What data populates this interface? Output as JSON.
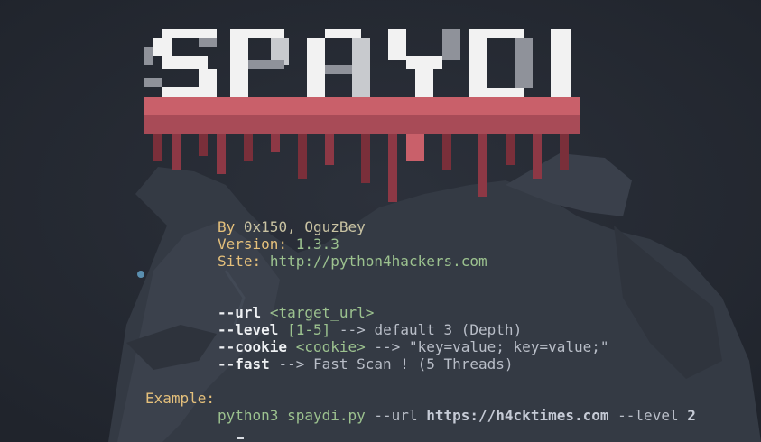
{
  "banner": {
    "logo_text": "SPAYDI",
    "colors": {
      "white": "#f2f2f2",
      "gray": "#8f929a",
      "red": "#c9606a",
      "dark_red": "#7a2f3a"
    }
  },
  "credits": {
    "by_label": "By",
    "authors": "0x150, OguzBey",
    "version_label": "Version:",
    "version": "1.3.3",
    "site_label": "Site:",
    "site_url": "http://python4hackers.com"
  },
  "options": {
    "url": {
      "flag": "--url",
      "arg": "<target_url>"
    },
    "level": {
      "flag": "--level",
      "arg": "[1-5]",
      "arrow": "-->",
      "desc": "default 3 (Depth)"
    },
    "cookie": {
      "flag": "--cookie",
      "arg": "<cookie>",
      "arrow": "-->",
      "desc": "\"key=value; key=value;\""
    },
    "fast": {
      "flag": "--fast",
      "arrow": "-->",
      "desc": "Fast Scan ! (5 Threads)"
    }
  },
  "example": {
    "label": "Example:",
    "cmd": "python3 spaydi.py",
    "url_flag": "--url",
    "url": "https://h4cktimes.com",
    "level_flag": "--level",
    "level_value": "2"
  },
  "colors": {
    "background": "#262a33",
    "yellow": "#e5c07b",
    "green": "#9cc28f",
    "gray": "#b9bec8",
    "white": "#eef0f3"
  }
}
